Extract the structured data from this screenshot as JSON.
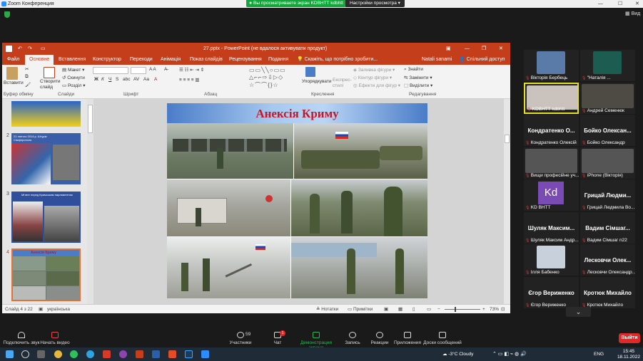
{
  "zoom": {
    "title": "Zoom Конференция",
    "share_banner": "Вы просматриваете экран KDBHTT kdbhtt",
    "view_options": "Настройки просмотра",
    "gallery_view": "Вид",
    "toolbar": [
      {
        "label": "Подключить звук",
        "icon": "headphone-icon"
      },
      {
        "label": "Начать видео",
        "icon": "video-off-icon"
      },
      {
        "label": "Участники",
        "icon": "participants-icon",
        "count": "59"
      },
      {
        "label": "Чат",
        "icon": "chat-icon",
        "badge": "1"
      },
      {
        "label": "Демонстрация экрана",
        "icon": "share-screen-icon"
      },
      {
        "label": "Запись",
        "icon": "record-icon"
      },
      {
        "label": "Реакции",
        "icon": "reactions-icon"
      },
      {
        "label": "Приложения",
        "icon": "apps-icon"
      },
      {
        "label": "Доски сообщений",
        "icon": "whiteboard-icon"
      }
    ],
    "end_button": "Выйти"
  },
  "ppt": {
    "title": "27.pptx - PowerPoint (не вдалося активувати продукт)",
    "tabs": [
      "Файл",
      "Основне",
      "Вставлення",
      "Конструктор",
      "Переходи",
      "Анімація",
      "Показ слайдів",
      "Рецензування",
      "Подання"
    ],
    "tell_me": "Скажіть, що потрібно зробити...",
    "user": "Natali sanami",
    "share": "Спільний доступ",
    "ribbon": {
      "paste": "Вставити",
      "clipboard": "Буфер обміну",
      "new_slide": "Створити слайд",
      "layout": "Макет",
      "reset": "Скинути",
      "sections": "Розділ",
      "slides": "Слайди",
      "font": "Шрифт",
      "paragraph": "Абзац",
      "arrange": "Упорядкувати",
      "quick_styles": "Експрес-стилі",
      "fill": "Заливка фігури",
      "outline": "Контур фігури",
      "effects": "Ефекти для фігур",
      "drawing": "Креслення",
      "find": "Знайти",
      "replace": "Замінити",
      "select": "Виділити",
      "editing": "Редагування"
    },
    "thumbs": [
      {
        "num": "2",
        "caption": "21 лютого 2014 р. Штурм Сімферополя"
      },
      {
        "num": "3",
        "caption": "Мітинг перед Кримським парламентом"
      },
      {
        "num": "4",
        "caption": "Анексія Криму"
      }
    ],
    "slide_title": "Анексія Криму",
    "status": {
      "slide": "Слайд 4 з 22",
      "lang": "українська",
      "notes": "Нотатки",
      "comments": "Примітки",
      "zoom": "73%"
    }
  },
  "participants": [
    {
      "name": "Вікторія Бербець",
      "kind": "image"
    },
    {
      "name": "\"Наталія ...",
      "kind": "image"
    },
    {
      "name": "KDBHTT kdbhtt",
      "kind": "video",
      "active": true
    },
    {
      "name": "Андрей Семенюк",
      "kind": "video"
    },
    {
      "name": "Кондратенко Олексій",
      "big": "Кондратенко О...",
      "kind": "text"
    },
    {
      "name": "Бойко Олександр",
      "big": "Бойко Олексан...",
      "kind": "text"
    },
    {
      "name": "Вищи професійне уч...",
      "kind": "video"
    },
    {
      "name": "iPhone (Вікторія)",
      "kind": "video"
    },
    {
      "name": "KD ВНТТ",
      "initials": "Kd",
      "kind": "avatar"
    },
    {
      "name": "Грицай Людмила Во...",
      "big": "Грицай Людми...",
      "kind": "text"
    },
    {
      "name": "Шуляк Максим Андр...",
      "big": "Шуляк Максим...",
      "kind": "text"
    },
    {
      "name": "Вадим Сімшаг n22",
      "big": "Вадим Сімшаг...",
      "kind": "text"
    },
    {
      "name": "Ілля Бабенко",
      "kind": "image"
    },
    {
      "name": "Лесковчи Олександр...",
      "big": "Лесковчи Олек...",
      "kind": "text"
    },
    {
      "name": "Єгор Вериженко",
      "big": "Єгор Вериженко",
      "kind": "text"
    },
    {
      "name": "Кротюк Михайло",
      "big": "Кротюк Михайло",
      "kind": "text"
    }
  ],
  "taskbar": {
    "weather": "-3°C Cloudy",
    "lang": "ENG",
    "time": "15:45",
    "date": "18.11.2022"
  },
  "colors": {
    "ppt_accent": "#c43e1c",
    "share_green": "#12a63b",
    "zoom_bg": "#1a1a1a",
    "end_red": "#e02828",
    "title_red": "#c0192b"
  }
}
